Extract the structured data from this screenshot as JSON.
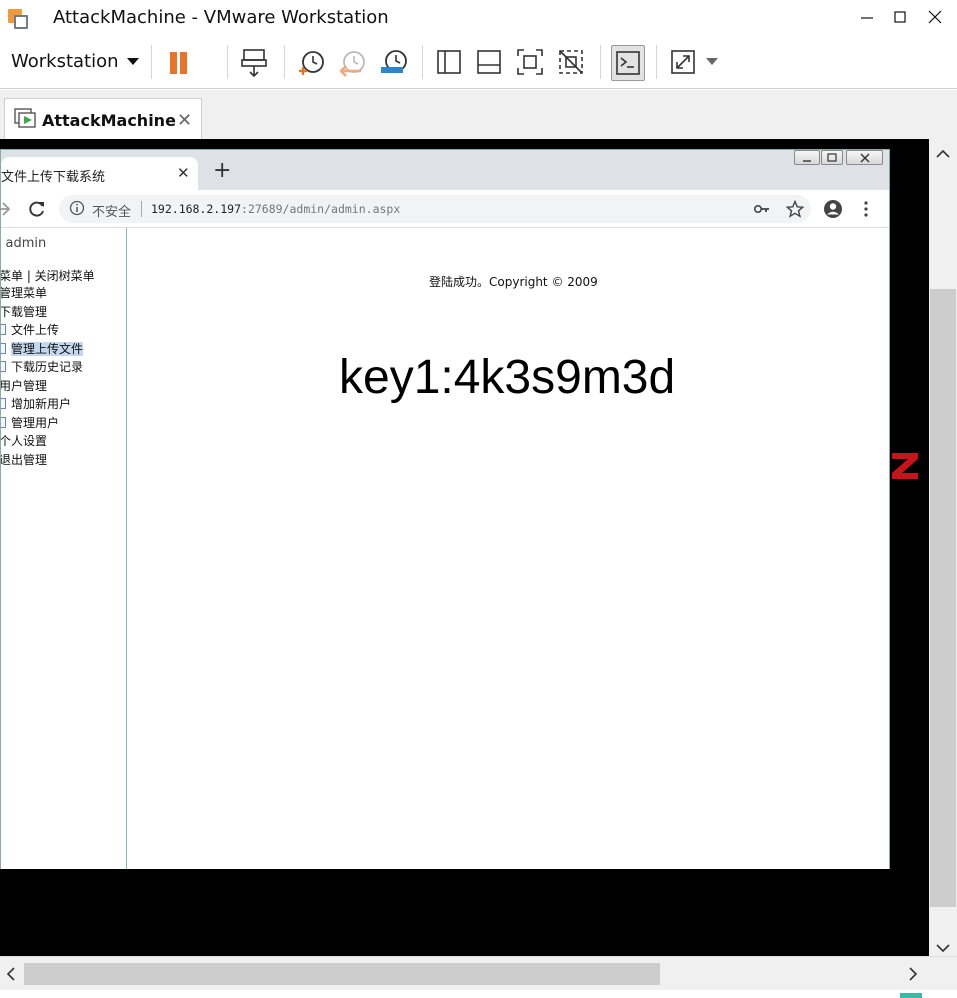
{
  "window": {
    "title": "AttackMachine - VMware Workstation"
  },
  "toolbar": {
    "workstation_menu": "Workstation",
    "buttons": [
      "pause-icon",
      "pause-dropdown-icon",
      "send-ctrl-alt-del-icon",
      "snapshot-take-icon",
      "snapshot-revert-icon",
      "snapshot-manager-icon",
      "library-view-icon",
      "thumbnail-bar-icon",
      "full-screen-icon",
      "unity-icon",
      "console-view-icon",
      "stretch-icon",
      "stretch-dropdown-icon"
    ],
    "accent_pause": "#e8742a"
  },
  "vm_tab": {
    "label": "AttackMachine",
    "close": "✕"
  },
  "guest_browser": {
    "tab_title": "文件上传下载系统",
    "tab_close": "✕",
    "new_tab": "+",
    "security_label": "不安全",
    "url_host": "192.168.2.197",
    "url_rest": ":27689/admin/admin.aspx"
  },
  "left_menu": {
    "user": ": admin",
    "expand_collapse": "菜单 | 关闭树菜单",
    "root": "管理菜单",
    "groups": [
      {
        "label": "下载管理",
        "items": [
          "文件上传",
          "管理上传文件",
          "下载历史记录"
        ]
      },
      {
        "label": "用户管理",
        "items": [
          "增加新用户",
          "管理用户"
        ]
      },
      {
        "label": "个人设置",
        "items": []
      },
      {
        "label": "退出管理",
        "items": []
      }
    ]
  },
  "main": {
    "login_message": "登陆成功。Copyright © 2009",
    "key_text": "key1:4k3s9m3d"
  }
}
